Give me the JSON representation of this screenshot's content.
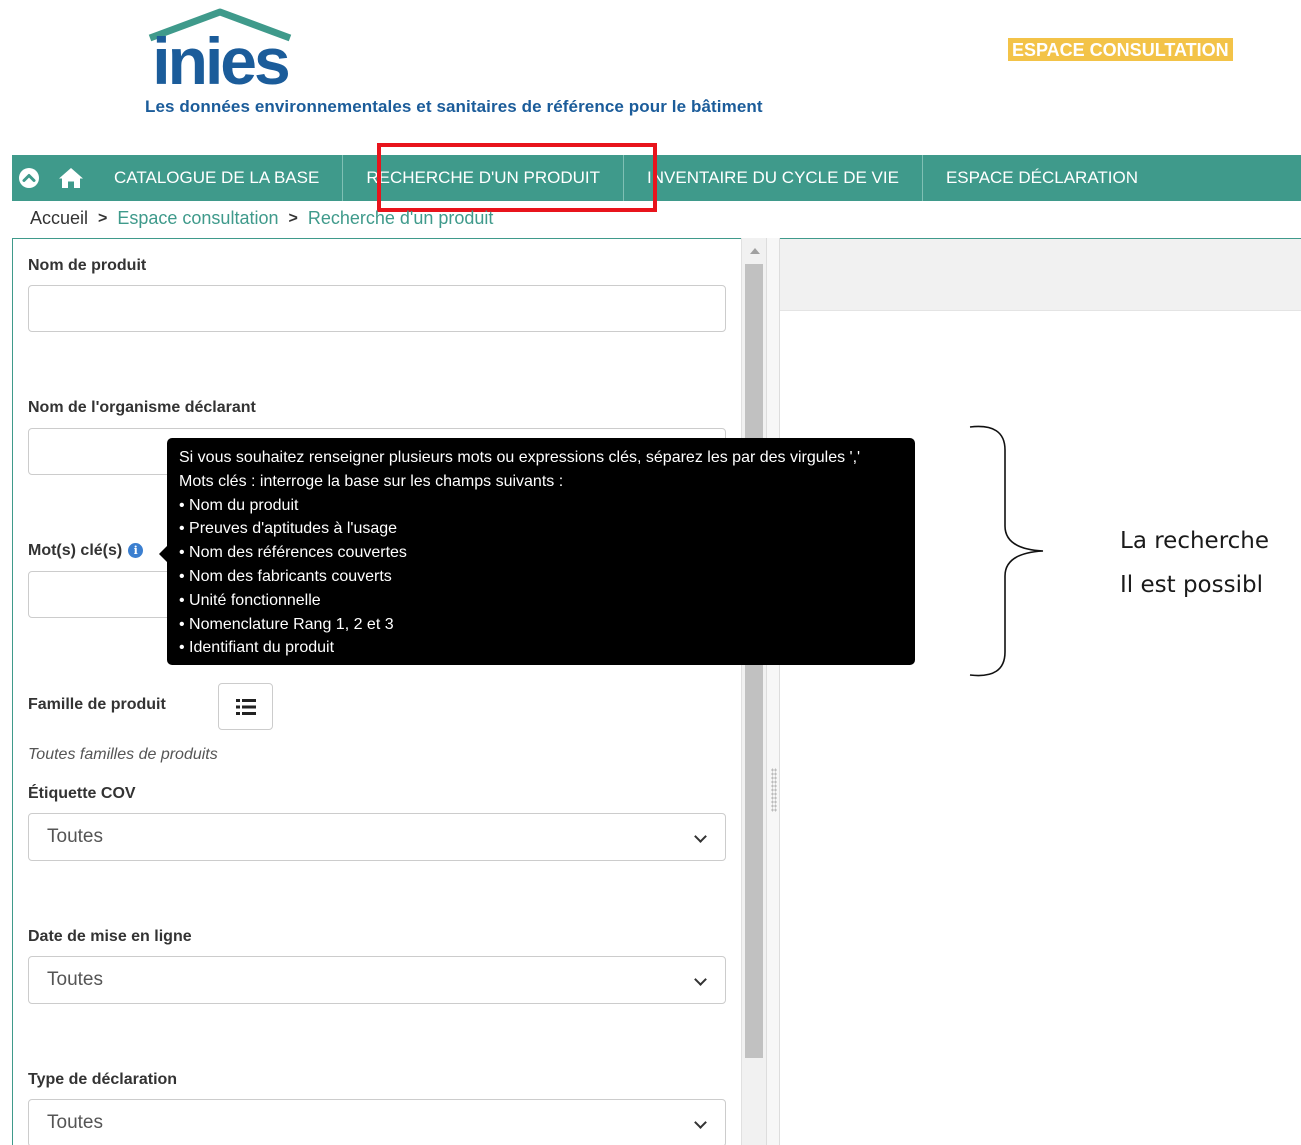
{
  "header": {
    "logo_text": "inies",
    "tagline": "Les données environnementales et sanitaires de référence pour le bâtiment",
    "espace_badge": "ESPACE CONSULTATION"
  },
  "nav": {
    "items": [
      {
        "label": "CATALOGUE DE LA BASE"
      },
      {
        "label": "RECHERCHE D'UN PRODUIT"
      },
      {
        "label": "INVENTAIRE DU CYCLE DE VIE"
      },
      {
        "label": "ESPACE DÉCLARATION"
      }
    ]
  },
  "breadcrumb": {
    "home": "Accueil",
    "separator": ">",
    "level1": "Espace consultation",
    "level2": "Recherche d'un produit"
  },
  "form": {
    "product_name_label": "Nom de produit",
    "product_name_value": "",
    "organisme_label": "Nom de l'organisme déclarant",
    "organisme_value": "",
    "keywords_label": "Mot(s) clé(s)",
    "keywords_value": "",
    "famille_label": "Famille de produit",
    "famille_sub": "Toutes familles de produits",
    "cov_label": "Étiquette COV",
    "cov_value": "Toutes",
    "date_label": "Date de mise en ligne",
    "date_value": "Toutes",
    "type_label": "Type de déclaration",
    "type_value": "Toutes"
  },
  "tooltip": {
    "lines": [
      "Si vous souhaitez renseigner plusieurs mots ou expressions clés, séparez les par des virgules ','",
      "Mots clés : interroge la base sur les champs suivants :",
      "• Nom du produit",
      "• Preuves d'aptitudes à l'usage",
      "• Nom des références couvertes",
      "• Nom des fabricants couverts",
      "• Unité fonctionnelle",
      "• Nomenclature Rang 1, 2 et 3",
      "• Identifiant du produit"
    ]
  },
  "annotation": {
    "line1": "La recherche",
    "line2": "Il est possibl"
  },
  "colors": {
    "nav_bg": "#3f9a8b",
    "badge_bg": "#f3c348",
    "highlight": "#e8141c",
    "tagline": "#1b5c9a",
    "logo": "#1b5c9a",
    "logo_roof": "#3f9a8b"
  },
  "icons": [
    "chevron-up-circle-icon",
    "home-icon",
    "list-icon",
    "info-icon",
    "chevron-down-icon"
  ]
}
